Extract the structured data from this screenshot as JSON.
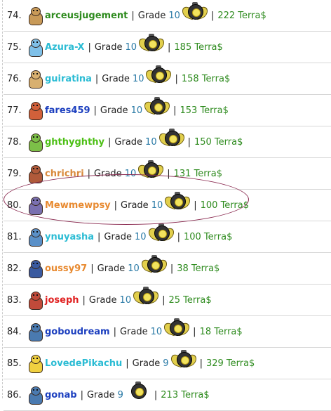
{
  "rankings": [
    {
      "rank": "74.",
      "user": "arceusjugement",
      "user_color": "#2e8b1e",
      "grade_label": "Grade",
      "grade": "10",
      "badge": "winged-badge-icon",
      "terra": "222 Terra$",
      "avatar_color": "#c89a58"
    },
    {
      "rank": "75.",
      "user": "Azura-X",
      "user_color": "#2bbcd4",
      "grade_label": "Grade",
      "grade": "10",
      "badge": "winged-badge-icon",
      "terra": "185 Terra$",
      "avatar_color": "#7fc0e8"
    },
    {
      "rank": "76.",
      "user": "guiratina",
      "user_color": "#2bbcd4",
      "grade_label": "Grade",
      "grade": "10",
      "badge": "winged-badge-icon",
      "terra": "158 Terra$",
      "avatar_color": "#d8b070"
    },
    {
      "rank": "77.",
      "user": "fares459",
      "user_color": "#1c3fbf",
      "grade_label": "Grade",
      "grade": "10",
      "badge": "winged-badge-icon",
      "terra": "153 Terra$",
      "avatar_color": "#d2603a"
    },
    {
      "rank": "78.",
      "user": "ghthyghthy",
      "user_color": "#4cbf14",
      "grade_label": "Grade",
      "grade": "10",
      "badge": "winged-badge-icon",
      "terra": "150 Terra$",
      "avatar_color": "#7cbf48"
    },
    {
      "rank": "79.",
      "user": "chrichri",
      "user_color": "#d98a3c",
      "grade_label": "Grade",
      "grade": "10",
      "badge": "winged-badge-icon",
      "terra": "131 Terra$",
      "avatar_color": "#b05a3a"
    },
    {
      "rank": "80.",
      "user": "Mewmewpsy",
      "user_color": "#e88a30",
      "grade_label": "Grade",
      "grade": "10",
      "badge": "winged-badge-icon",
      "terra": "100 Terra$",
      "avatar_color": "#7a70b0"
    },
    {
      "rank": "81.",
      "user": "ynuyasha",
      "user_color": "#2bbcd4",
      "grade_label": "Grade",
      "grade": "10",
      "badge": "winged-badge-icon",
      "terra": "100 Terra$",
      "avatar_color": "#5a90c8"
    },
    {
      "rank": "82.",
      "user": "oussy97",
      "user_color": "#e88a30",
      "grade_label": "Grade",
      "grade": "10",
      "badge": "winged-badge-icon",
      "terra": "38 Terra$",
      "avatar_color": "#3a5aa0"
    },
    {
      "rank": "83.",
      "user": "joseph",
      "user_color": "#e02020",
      "grade_label": "Grade",
      "grade": "10",
      "badge": "winged-badge-icon",
      "terra": "25 Terra$",
      "avatar_color": "#c04a3a"
    },
    {
      "rank": "84.",
      "user": "goboudream",
      "user_color": "#1c3fbf",
      "grade_label": "Grade",
      "grade": "10",
      "badge": "winged-badge-icon",
      "terra": "18 Terra$",
      "avatar_color": "#4a7ab0"
    },
    {
      "rank": "85.",
      "user": "LovedePikachu",
      "user_color": "#2bbcd4",
      "grade_label": "Grade",
      "grade": "9",
      "badge": "winged-badge-icon",
      "terra": "329 Terra$",
      "avatar_color": "#f0d040"
    },
    {
      "rank": "86.",
      "user": "gonab",
      "user_color": "#1c3fbf",
      "grade_label": "Grade",
      "grade": "9",
      "badge": "badge-icon",
      "terra": "213 Terra$",
      "avatar_color": "#4a7ab0"
    }
  ],
  "separator": "|",
  "highlight_color": "#8a2a50"
}
